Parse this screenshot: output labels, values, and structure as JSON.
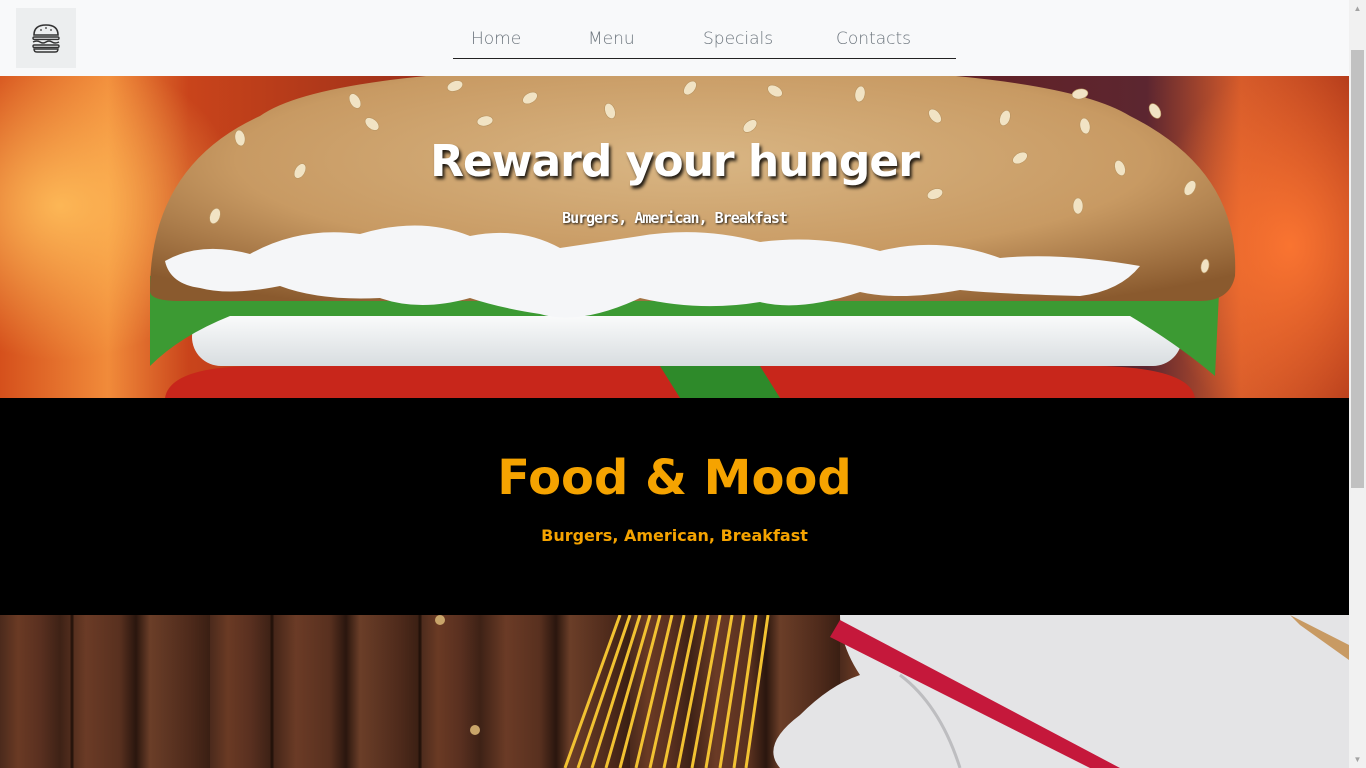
{
  "navbar": {
    "logo_icon": "burger-icon",
    "links": [
      {
        "label": "Home"
      },
      {
        "label": "Menu"
      },
      {
        "label": "Specials"
      },
      {
        "label": "Contacts"
      }
    ]
  },
  "hero": {
    "title": "Reward your hunger",
    "subtitle": "Burgers, American, Breakfast"
  },
  "mood": {
    "title": "Food & Mood",
    "subtitle": "Burgers, American, Breakfast",
    "accent_color": "#f5a300"
  }
}
